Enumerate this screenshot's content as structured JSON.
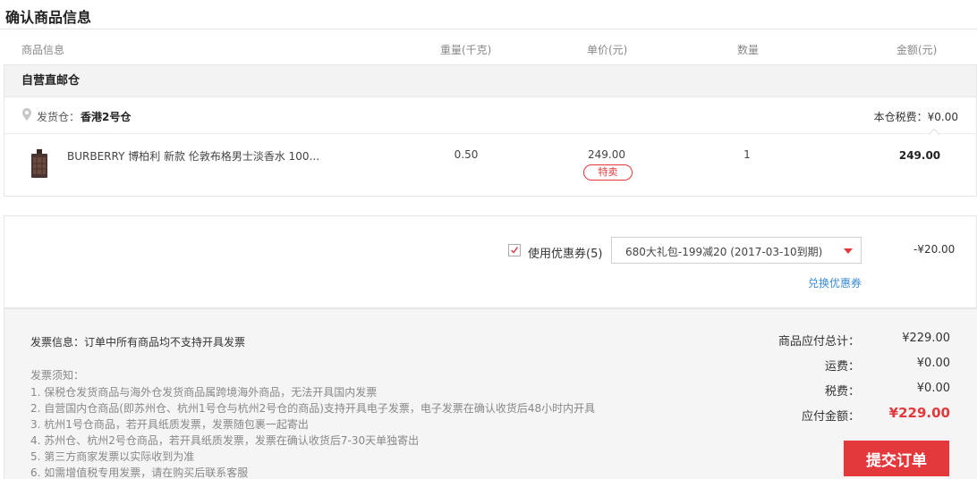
{
  "page": {
    "title": "确认商品信息"
  },
  "columns": {
    "info": "商品信息",
    "weight": "重量(千克)",
    "price": "单价(元)",
    "qty": "数量",
    "amount": "金额(元)"
  },
  "warehouse": {
    "name": "自营直邮仓",
    "ship_label": "发货仓：",
    "ship_value": "香港2号仓",
    "tax_label": "本仓税费：¥0.00"
  },
  "product": {
    "name": "BURBERRY 博柏利 新款 伦敦布格男士淡香水 100...",
    "weight": "0.50",
    "price": "249.00",
    "badge": "特卖",
    "qty": "1",
    "amount": "249.00"
  },
  "coupon": {
    "checked": true,
    "label": "使用优惠券(5)",
    "selected": "680大礼包-199减20 (2017-03-10到期)",
    "discount": "-¥20.00",
    "exchange_link": "兑换优惠券"
  },
  "invoice": {
    "info": "发票信息：订单中所有商品均不支持开具发票",
    "notice_title": "发票须知：",
    "notices": [
      "1. 保税仓发货商品与海外仓发货商品属跨境海外商品，无法开具国内发票",
      "2. 自营国内仓商品(即苏州仓、杭州1号仓与杭州2号仓的商品)支持开具电子发票，电子发票在确认收货后48小时内开具",
      "3. 杭州1号仓商品，若开具纸质发票，发票随包裹一起寄出",
      "4. 苏州仓、杭州2号仓商品，若开具纸质发票，发票在确认收货后7-30天单独寄出",
      "5. 第三方商家发票以实际收到为准",
      "6. 如需增值税专用发票，请在购买后联系客服"
    ]
  },
  "summary": {
    "goods_total_label": "商品应付总计：",
    "goods_total": "¥229.00",
    "shipping_label": "运费：",
    "shipping": "¥0.00",
    "tax_label": "税费：",
    "tax": "¥0.00",
    "payable_label": "应付金额：",
    "payable": "¥229.00",
    "submit_label": "提交订单"
  },
  "colors": {
    "accent": "#e4393c",
    "link": "#3a8bd8"
  },
  "icons": {
    "location": "location-pin-icon",
    "dropdown": "caret-down-icon",
    "check": "checkmark-icon"
  }
}
